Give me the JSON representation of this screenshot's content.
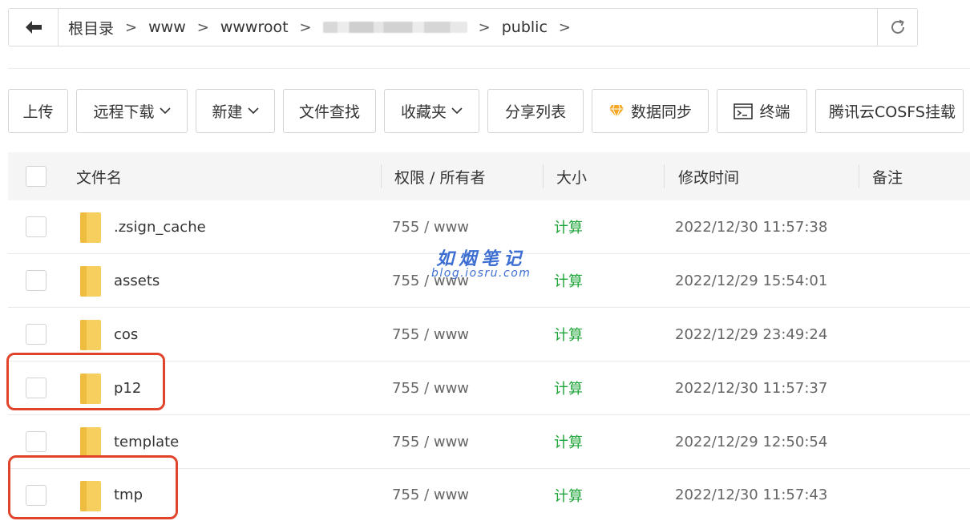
{
  "breadcrumb": {
    "items": [
      "根目录",
      "www",
      "wwwroot",
      "public"
    ],
    "separator": ">"
  },
  "toolbar": {
    "upload": "上传",
    "remote_download": "远程下载",
    "new": "新建",
    "search_files": "文件查找",
    "favorites": "收藏夹",
    "share_list": "分享列表",
    "data_sync": "数据同步",
    "terminal": "终端",
    "cosfs_mount": "腾讯云COSFS挂载"
  },
  "table": {
    "columns": [
      "文件名",
      "权限 / 所有者",
      "大小",
      "修改时间",
      "备注"
    ],
    "rows": [
      {
        "name": ".zsign_cache",
        "perm": "755 / www",
        "size": "计算",
        "mtime": "2022/12/30 11:57:38"
      },
      {
        "name": "assets",
        "perm": "755 / www",
        "size": "计算",
        "mtime": "2022/12/29 15:54:01"
      },
      {
        "name": "cos",
        "perm": "755 / www",
        "size": "计算",
        "mtime": "2022/12/29 23:49:24"
      },
      {
        "name": "p12",
        "perm": "755 / www",
        "size": "计算",
        "mtime": "2022/12/30 11:57:37"
      },
      {
        "name": "template",
        "perm": "755 / www",
        "size": "计算",
        "mtime": "2022/12/29 12:50:54"
      },
      {
        "name": "tmp",
        "perm": "755 / www",
        "size": "计算",
        "mtime": "2022/12/30 11:57:43"
      }
    ]
  },
  "watermark": {
    "title": "如烟笔记",
    "subtitle": "blog.iosru.com"
  },
  "colors": {
    "accent_green": "#20a53a",
    "highlight_red": "#e0442b",
    "folder_yellow": "#f7cf5f",
    "gem_orange": "#f5a623",
    "watermark_blue": "#3d6fd2"
  },
  "icons": {
    "back": "arrow-left-icon",
    "refresh": "refresh-icon",
    "chevron": "chevron-down-icon",
    "gem": "diamond-icon",
    "terminal": "terminal-icon",
    "folder": "folder-icon"
  }
}
